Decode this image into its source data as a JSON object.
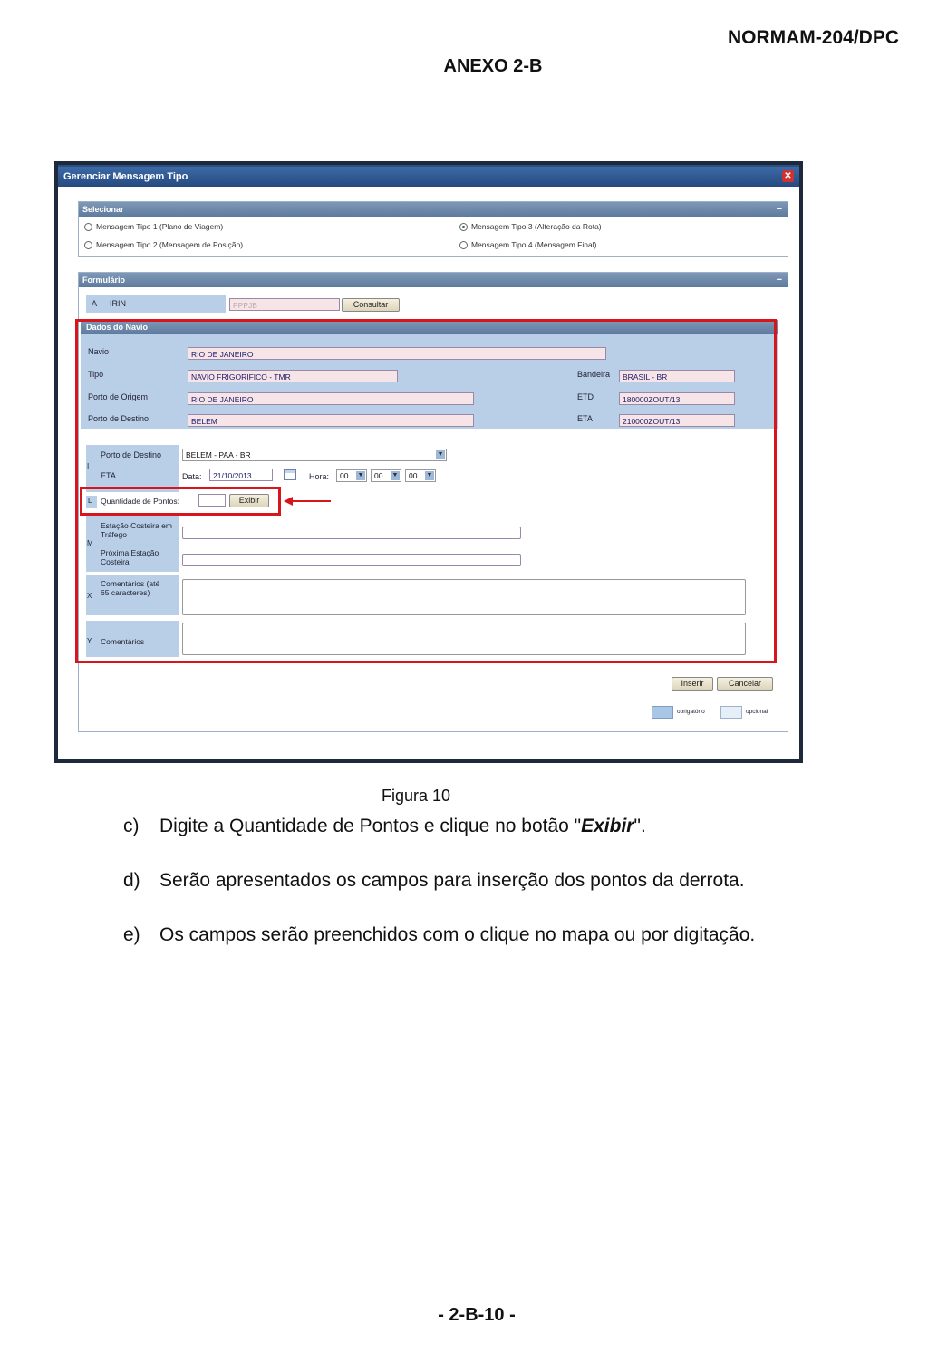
{
  "header": {
    "code": "NORMAM-204/DPC",
    "annex": "ANEXO 2-B"
  },
  "window": {
    "title": "Gerenciar Mensagem Tipo",
    "select_panel": {
      "title": "Selecionar",
      "options": [
        {
          "label": "Mensagem Tipo 1 (Plano de Viagem)",
          "selected": false
        },
        {
          "label": "Mensagem Tipo 2 (Mensagem de Posição)",
          "selected": false
        },
        {
          "label": "Mensagem Tipo 3 (Alteração da Rota)",
          "selected": true
        },
        {
          "label": "Mensagem Tipo 4 (Mensagem Final)",
          "selected": false
        }
      ]
    },
    "form_panel": {
      "title": "Formulário",
      "row_a": {
        "letter": "A",
        "label": "IRIN",
        "value": "PPPJB",
        "button": "Consultar"
      },
      "ship_data": {
        "title": "Dados do Navio",
        "navio_label": "Navio",
        "navio": "RIO DE JANEIRO",
        "tipo_label": "Tipo",
        "tipo": "NAVIO FRIGORIFICO - TMR",
        "origem_label": "Porto de Origem",
        "origem": "RIO DE JANEIRO",
        "destino_label": "Porto de Destino",
        "destino": "BELEM",
        "bandeira_label": "Bandeira",
        "bandeira": "BRASIL - BR",
        "etd_label": "ETD",
        "etd": "180000ZOUT/13",
        "eta_label": "ETA",
        "eta": "210000ZOUT/13"
      },
      "row_i": {
        "letter": "I",
        "destino_label": "Porto de Destino",
        "destino_value": "BELEM - PAA - BR",
        "eta_label": "ETA",
        "data_label": "Data:",
        "data_value": "21/10/2013",
        "hora_label": "Hora:",
        "hh": "00",
        "mm": "00",
        "ss": "00"
      },
      "row_l": {
        "letter": "L",
        "label": "Quantidade de Pontos:",
        "button": "Exibir"
      },
      "row_m": {
        "letter": "M",
        "label1": "Estação Costeira em Tráfego",
        "label2": "Próxima Estação Costeira"
      },
      "row_x": {
        "letter": "X",
        "label": "Comentários (até 65 caracteres)"
      },
      "row_y": {
        "letter": "Y",
        "label": "Comentários"
      },
      "buttons": {
        "insert": "Inserir",
        "cancel": "Cancelar"
      },
      "legend": {
        "required": "obrigatório",
        "optional": "opcional"
      }
    }
  },
  "caption": "Figura 10",
  "steps": [
    {
      "marker": "c)",
      "before": "Digite a Quantidade de Pontos e clique no botão \"",
      "emph": "Exibir",
      "after": "\"."
    },
    {
      "marker": "d)",
      "text": "Serão apresentados os campos para inserção dos pontos da derrota."
    },
    {
      "marker": "e)",
      "text": "Os campos serão preenchidos com o clique no mapa ou por digitação."
    }
  ],
  "page_number": "- 2-B-10 -",
  "colors": {
    "highlight": "#d6161c",
    "required": "#b9cfe7",
    "titlebar": "#254a80"
  }
}
